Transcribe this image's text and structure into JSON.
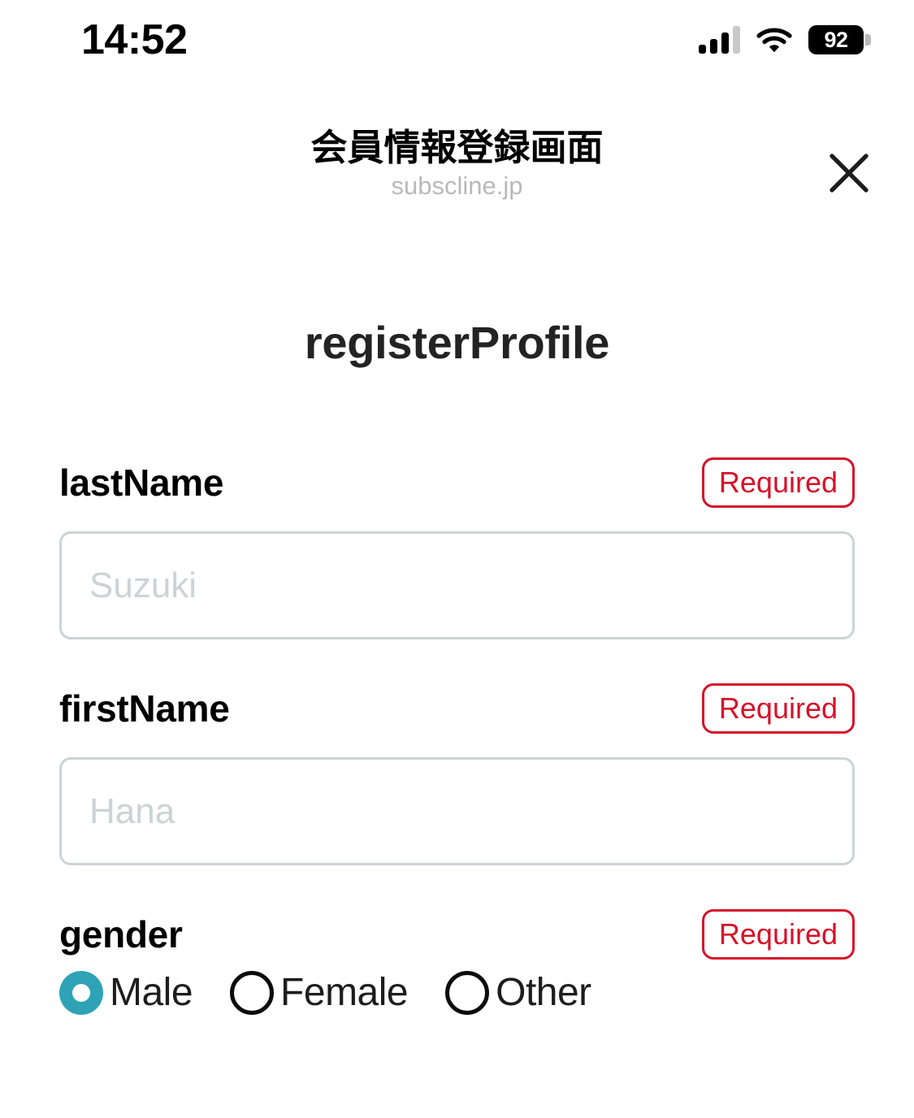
{
  "status_bar": {
    "time": "14:52",
    "battery_level": "92",
    "signal_icon": "cellular-signal-icon",
    "wifi_icon": "wifi-icon",
    "battery_icon": "battery-icon"
  },
  "header": {
    "title": "会員情報登録画面",
    "subtitle": "subscline.jp",
    "close_icon": "close-icon"
  },
  "main": {
    "page_title": "registerProfile",
    "fields": [
      {
        "label": "lastName",
        "badge": "Required",
        "placeholder": "Suzuki",
        "value": ""
      },
      {
        "label": "firstName",
        "badge": "Required",
        "placeholder": "Hana",
        "value": ""
      }
    ],
    "gender": {
      "label": "gender",
      "badge": "Required",
      "selected": "Male",
      "options": [
        {
          "label": "Male",
          "checked": true
        },
        {
          "label": "Female",
          "checked": false
        },
        {
          "label": "Other",
          "checked": false
        }
      ]
    }
  },
  "colors": {
    "required_red": "#d6122a",
    "radio_selected_teal": "#2ea3b5",
    "input_border_gray": "#ccd3d6",
    "placeholder_gray": "#ccd3d6",
    "subtitle_gray": "#b9b9b9",
    "title_dark": "#232323",
    "background": "#ffffff"
  }
}
